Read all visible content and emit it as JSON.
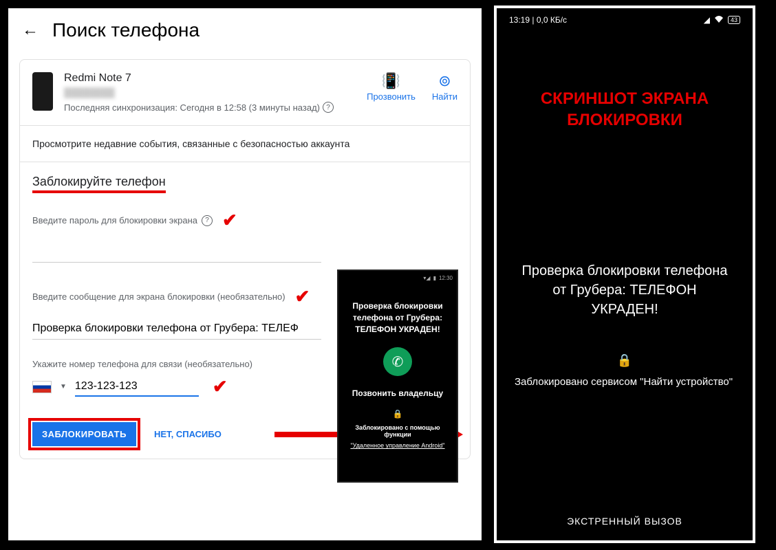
{
  "header": {
    "title": "Поиск телефона"
  },
  "device": {
    "name": "Redmi Note 7",
    "sync": "Последняя синхронизация: Сегодня в 12:58 (3 минуты назад)"
  },
  "actions": {
    "ring": "Прозвонить",
    "find": "Найти"
  },
  "security_text": "Просмотрите недавние события, связанные с безопасностью аккаунта",
  "lock": {
    "title": "Заблокируйте телефон",
    "pwd_label": "Введите пароль для блокировки экрана",
    "msg_label": "Введите сообщение для экрана блокировки (необязательно)",
    "msg_value": "Проверка блокировки телефона от Грубера: ТЕЛЕФ",
    "phone_label": "Укажите номер телефона для связи (необязательно)",
    "phone_value": "123-123-123",
    "btn_lock": "ЗАБЛОКИРОВАТЬ",
    "btn_no": "НЕТ, СПАСИБО"
  },
  "preview": {
    "time": "12:30",
    "msg": "Проверка блокировки телефона от Грубера: ТЕЛЕФОН УКРАДЕН!",
    "call_owner": "Позвонить владельцу",
    "locked_with": "Заблокировано с помощью функции",
    "remote": "\"Удаленное управление Android\""
  },
  "lockscreen": {
    "time": "13:19",
    "speed": "0,0 КБ/с",
    "battery": "43",
    "red_title": "СКРИНШОТ ЭКРАНА БЛОКИРОВКИ",
    "msg": "Проверка блокировки телефона от Грубера: ТЕЛЕФОН УКРАДЕН!",
    "locked_by": "Заблокировано сервисом \"Найти устройство\"",
    "emergency": "ЭКСТРЕННЫЙ ВЫЗОВ"
  }
}
